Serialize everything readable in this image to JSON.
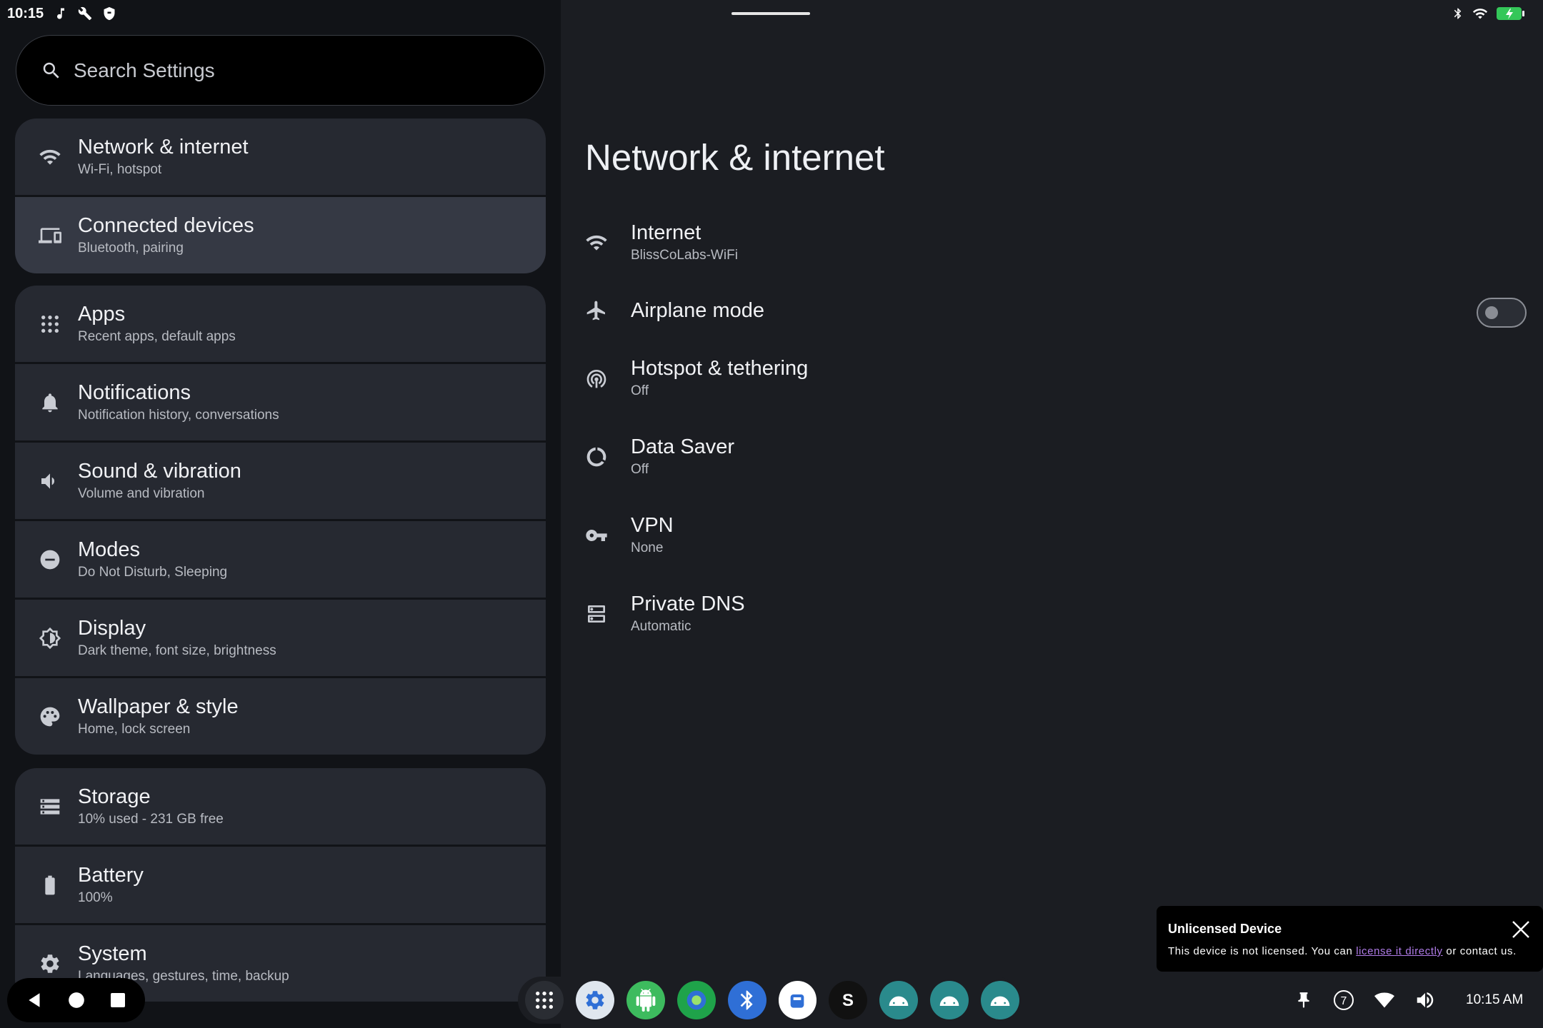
{
  "status_bar": {
    "time": "10:15"
  },
  "search": {
    "placeholder": "Search Settings"
  },
  "sidebar": {
    "groups": [
      [
        {
          "title": "Network & internet",
          "subtitle": "Wi-Fi, hotspot",
          "icon": "wifi-icon"
        },
        {
          "title": "Connected devices",
          "subtitle": "Bluetooth, pairing",
          "icon": "devices-icon"
        }
      ],
      [
        {
          "title": "Apps",
          "subtitle": "Recent apps, default apps",
          "icon": "apps-grid-icon"
        },
        {
          "title": "Notifications",
          "subtitle": "Notification history, conversations",
          "icon": "bell-icon"
        },
        {
          "title": "Sound & vibration",
          "subtitle": "Volume and vibration",
          "icon": "volume-icon"
        },
        {
          "title": "Modes",
          "subtitle": "Do Not Disturb, Sleeping",
          "icon": "do-not-disturb-icon"
        },
        {
          "title": "Display",
          "subtitle": "Dark theme, font size, brightness",
          "icon": "brightness-icon"
        },
        {
          "title": "Wallpaper & style",
          "subtitle": "Home, lock screen",
          "icon": "palette-icon"
        }
      ],
      [
        {
          "title": "Storage",
          "subtitle": "10% used - 231 GB free",
          "icon": "storage-icon"
        },
        {
          "title": "Battery",
          "subtitle": "100%",
          "icon": "battery-icon"
        },
        {
          "title": "System",
          "subtitle": "Languages, gestures, time, backup",
          "icon": "gear-icon"
        }
      ]
    ]
  },
  "main": {
    "title": "Network & internet",
    "rows": [
      {
        "title": "Internet",
        "subtitle": "BlissCoLabs-WiFi",
        "icon": "wifi-icon"
      },
      {
        "title": "Airplane mode",
        "subtitle": "",
        "icon": "airplane-icon",
        "toggle": false
      },
      {
        "title": "Hotspot & tethering",
        "subtitle": "Off",
        "icon": "hotspot-icon"
      },
      {
        "title": "Data Saver",
        "subtitle": "Off",
        "icon": "data-saver-icon"
      },
      {
        "title": "VPN",
        "subtitle": "None",
        "icon": "vpn-key-icon"
      },
      {
        "title": "Private DNS",
        "subtitle": "Automatic",
        "icon": "dns-icon"
      }
    ]
  },
  "toast": {
    "title": "Unlicensed Device",
    "message_before": "This device is not licensed. You can ",
    "link": "license it directly",
    "message_after": " or contact us."
  },
  "taskbar": {
    "time": "10:15 AM",
    "notification_count": "7",
    "apps": [
      {
        "name": "app-drawer",
        "color": "#2a2d33"
      },
      {
        "name": "settings-app",
        "color": "#dfe6ee"
      },
      {
        "name": "android-app-green",
        "color": "#3dbb5e"
      },
      {
        "name": "browser-app",
        "color": "#1fa34a"
      },
      {
        "name": "bluetooth-app",
        "color": "#2f6fd6"
      },
      {
        "name": "store-app",
        "color": "#ffffff"
      },
      {
        "name": "s-app",
        "color": "#111111"
      },
      {
        "name": "android-app-teal-1",
        "color": "#2a8a8c"
      },
      {
        "name": "android-app-teal-2",
        "color": "#2a8a8c"
      },
      {
        "name": "android-app-teal-3",
        "color": "#2a8a8c"
      }
    ]
  },
  "colors": {
    "accent_link": "#b07ce8",
    "battery": "#34c759"
  }
}
